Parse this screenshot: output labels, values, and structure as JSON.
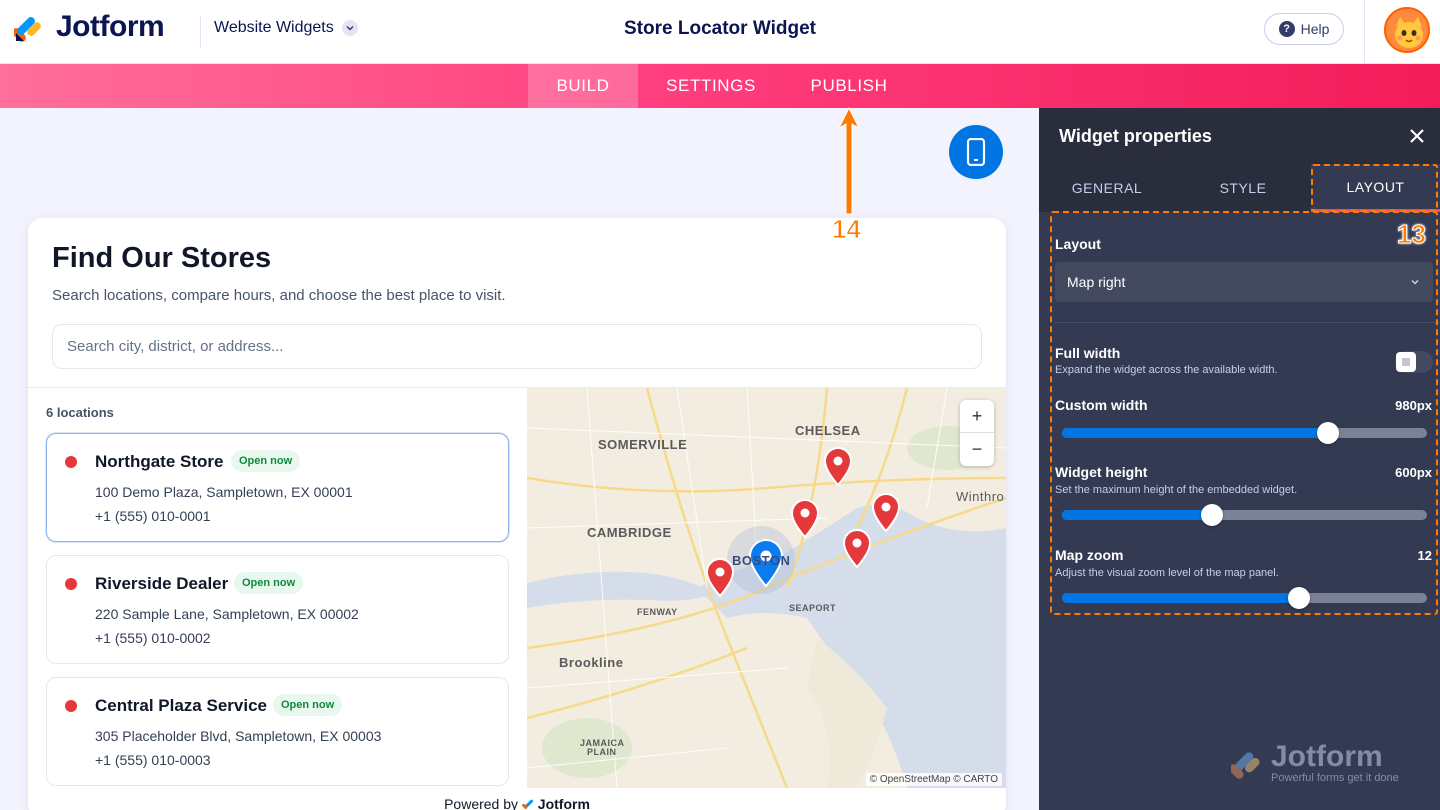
{
  "header": {
    "brand": "Jotform",
    "product": "Website Widgets",
    "title": "Store Locator Widget",
    "help_label": "Help"
  },
  "nav": {
    "tabs": [
      {
        "label": "BUILD",
        "active": true
      },
      {
        "label": "SETTINGS",
        "active": false
      },
      {
        "label": "PUBLISH",
        "active": false
      }
    ]
  },
  "annotations": {
    "publish_step": "14",
    "layout_step": "13"
  },
  "widget": {
    "title": "Find Our Stores",
    "subtitle": "Search locations, compare hours, and choose the best place to visit.",
    "search_placeholder": "Search city, district, or address...",
    "count": "6 locations",
    "stores": [
      {
        "name": "Northgate Store",
        "status": "Open now",
        "address": "100 Demo Plaza, Sampletown, EX 00001",
        "phone": "+1 (555) 010-0001"
      },
      {
        "name": "Riverside Dealer",
        "status": "Open now",
        "address": "220 Sample Lane, Sampletown, EX 00002",
        "phone": "+1 (555) 010-0002"
      },
      {
        "name": "Central Plaza Service",
        "status": "Open now",
        "address": "305 Placeholder Blvd, Sampletown, EX 00003",
        "phone": "+1 (555) 010-0003"
      }
    ],
    "map": {
      "zoom_in": "+",
      "zoom_out": "−",
      "attribution": "© OpenStreetMap © CARTO",
      "labels": {
        "somerville": "SOMERVILLE",
        "chelsea": "CHELSEA",
        "cambridge": "CAMBRIDGE",
        "boston": "BOSTON",
        "winthrop": "Winthro",
        "fenway": "FENWAY",
        "seaport": "SEAPORT",
        "brookline": "Brookline",
        "jamaica": "JAMAICA",
        "plain": "PLAIN"
      }
    },
    "powered_by": "Powered by",
    "powered_brand": "Jotform"
  },
  "panel": {
    "title": "Widget properties",
    "tabs": [
      {
        "label": "GENERAL",
        "active": false
      },
      {
        "label": "STYLE",
        "active": false
      },
      {
        "label": "LAYOUT",
        "active": true
      }
    ],
    "layout_label": "Layout",
    "layout_value": "Map right",
    "full_width": {
      "label": "Full width",
      "desc": "Expand the widget across the available width.",
      "on": false
    },
    "custom_width": {
      "label": "Custom width",
      "value": "980px",
      "fraction": 0.73
    },
    "widget_height": {
      "label": "Widget height",
      "desc": "Set the maximum height of the embedded widget.",
      "value": "600px",
      "fraction": 0.41
    },
    "map_zoom": {
      "label": "Map zoom",
      "desc": "Adjust the visual zoom level of the map panel.",
      "value": "12",
      "fraction": 0.65
    },
    "watermark": {
      "brand": "Jotform",
      "tagline": "Powerful forms get it done"
    }
  },
  "colors": {
    "accent_pink": "#ff3f7f",
    "primary_blue": "#0075e3",
    "annotation_orange": "#ff7a00",
    "pin_red": "#e5383b"
  }
}
